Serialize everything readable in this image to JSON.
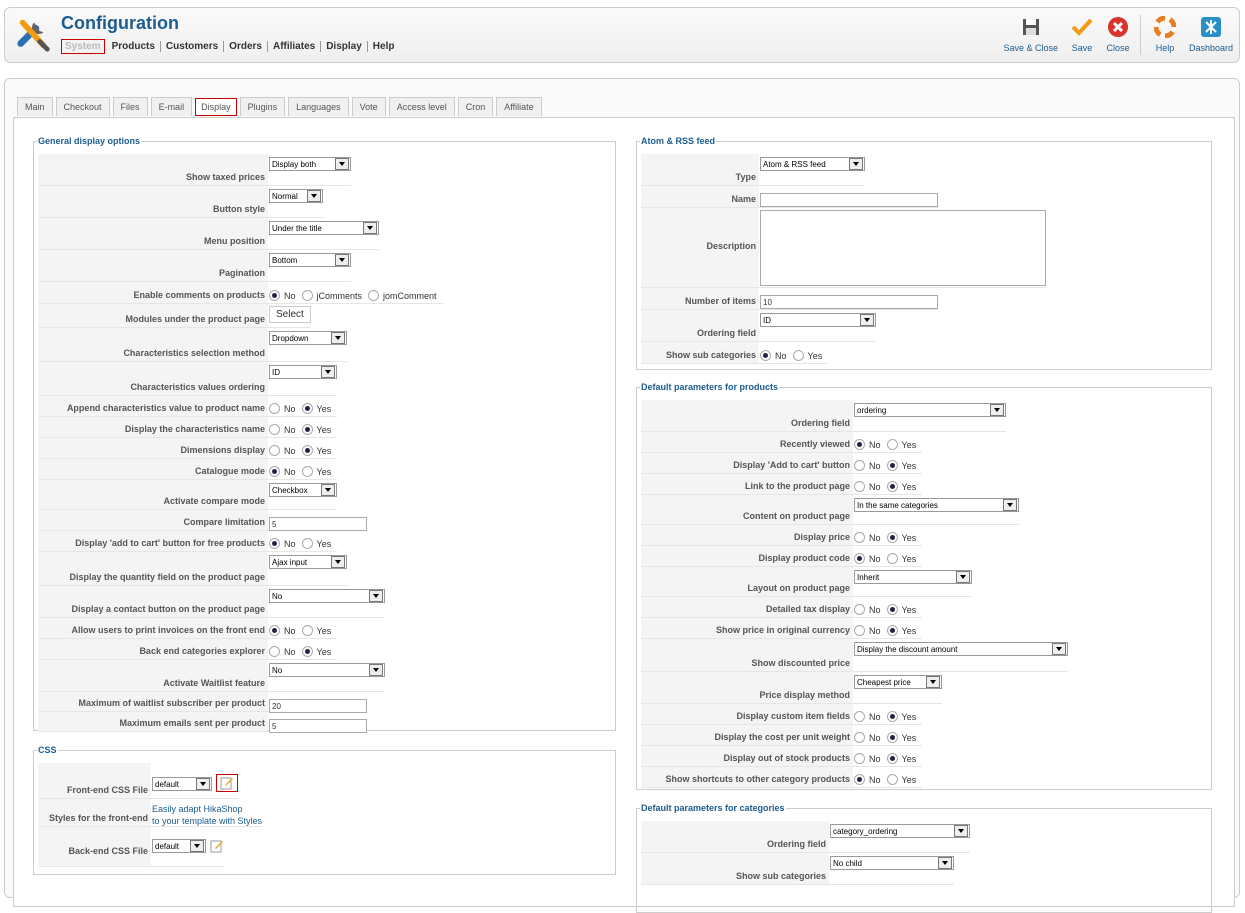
{
  "header": {
    "title": "Configuration",
    "nav": [
      "System",
      "Products",
      "Customers",
      "Orders",
      "Affiliates",
      "Display",
      "Help"
    ],
    "toolbar": {
      "save_close": "Save & Close",
      "save": "Save",
      "close": "Close",
      "help": "Help",
      "dashboard": "Dashboard"
    }
  },
  "tabs": [
    "Main",
    "Checkout",
    "Files",
    "E-mail",
    "Display",
    "Plugins",
    "Languages",
    "Vote",
    "Access level",
    "Cron",
    "Affiliate"
  ],
  "general": {
    "legend": "General display options",
    "rows": [
      {
        "label": "Show taxed prices",
        "type": "select",
        "value": "Display both"
      },
      {
        "label": "Button style",
        "type": "select",
        "value": "Normal"
      },
      {
        "label": "Menu position",
        "type": "select",
        "value": "Under the title"
      },
      {
        "label": "Pagination",
        "type": "select",
        "value": "Bottom"
      },
      {
        "label": "Enable comments on products",
        "type": "radio",
        "options": [
          "No",
          "jComments",
          "jomComment"
        ],
        "selected": 0
      },
      {
        "label": "Modules under the product page",
        "type": "button",
        "value": "Select"
      },
      {
        "label": "Characteristics selection method",
        "type": "select",
        "value": "Dropdown"
      },
      {
        "label": "Characteristics values ordering",
        "type": "select",
        "value": "ID"
      },
      {
        "label": "Append characteristics value to product name",
        "type": "radio",
        "options": [
          "No",
          "Yes"
        ],
        "selected": 1
      },
      {
        "label": "Display the characteristics name",
        "type": "radio",
        "options": [
          "No",
          "Yes"
        ],
        "selected": 1
      },
      {
        "label": "Dimensions display",
        "type": "radio",
        "options": [
          "No",
          "Yes"
        ],
        "selected": 1
      },
      {
        "label": "Catalogue mode",
        "type": "radio",
        "options": [
          "No",
          "Yes"
        ],
        "selected": 0
      },
      {
        "label": "Activate compare mode",
        "type": "select",
        "value": "Checkbox"
      },
      {
        "label": "Compare limitation",
        "type": "input",
        "value": "5"
      },
      {
        "label": "Display 'add to cart' button for free products",
        "type": "radio",
        "options": [
          "No",
          "Yes"
        ],
        "selected": 0
      },
      {
        "label": "Display the quantity field on the product page",
        "type": "select",
        "value": "Ajax input"
      },
      {
        "label": "Display a contact button on the product page",
        "type": "select",
        "value": "No"
      },
      {
        "label": "Allow users to print invoices on the front end",
        "type": "radio",
        "options": [
          "No",
          "Yes"
        ],
        "selected": 0
      },
      {
        "label": "Back end categories explorer",
        "type": "radio",
        "options": [
          "No",
          "Yes"
        ],
        "selected": 1
      },
      {
        "label": "Activate Waitlist feature",
        "type": "select",
        "value": "No"
      },
      {
        "label": "Maximum of waitlist subscriber per product",
        "type": "input",
        "value": "20"
      },
      {
        "label": "Maximum emails sent per product",
        "type": "input",
        "value": "5"
      }
    ]
  },
  "css": {
    "legend": "CSS",
    "front_label": "Front-end CSS File",
    "front_value": "default",
    "styles_label": "Styles for the front-end",
    "styles_link1": "Easily adapt HikaShop",
    "styles_link2": "to your template with Styles",
    "back_label": "Back-end CSS File",
    "back_value": "default"
  },
  "rss": {
    "legend": "Atom & RSS feed",
    "rows": [
      {
        "label": "Type",
        "type": "select",
        "value": "Atom & RSS feed"
      },
      {
        "label": "Name",
        "type": "input",
        "value": ""
      },
      {
        "label": "Description",
        "type": "textarea",
        "value": ""
      },
      {
        "label": "Number of items",
        "type": "input",
        "value": "10"
      },
      {
        "label": "Ordering field",
        "type": "select",
        "value": "ID"
      },
      {
        "label": "Show sub categories",
        "type": "radio",
        "options": [
          "No",
          "Yes"
        ],
        "selected": 0
      }
    ]
  },
  "products": {
    "legend": "Default parameters for products",
    "rows": [
      {
        "label": "Ordering field",
        "type": "select",
        "value": "ordering"
      },
      {
        "label": "Recently viewed",
        "type": "radio",
        "options": [
          "No",
          "Yes"
        ],
        "selected": 0
      },
      {
        "label": "Display 'Add to cart' button",
        "type": "radio",
        "options": [
          "No",
          "Yes"
        ],
        "selected": 1
      },
      {
        "label": "Link to the product page",
        "type": "radio",
        "options": [
          "No",
          "Yes"
        ],
        "selected": 1
      },
      {
        "label": "Content on product page",
        "type": "select",
        "value": "In the same categories"
      },
      {
        "label": "Display price",
        "type": "radio",
        "options": [
          "No",
          "Yes"
        ],
        "selected": 1
      },
      {
        "label": "Display product code",
        "type": "radio",
        "options": [
          "No",
          "Yes"
        ],
        "selected": 0
      },
      {
        "label": "Layout on product page",
        "type": "select",
        "value": "Inherit"
      },
      {
        "label": "Detailed tax display",
        "type": "radio",
        "options": [
          "No",
          "Yes"
        ],
        "selected": 1
      },
      {
        "label": "Show price in original currency",
        "type": "radio",
        "options": [
          "No",
          "Yes"
        ],
        "selected": 1
      },
      {
        "label": "Show discounted price",
        "type": "select",
        "value": "Display the discount amount"
      },
      {
        "label": "Price display method",
        "type": "select",
        "value": "Cheapest price"
      },
      {
        "label": "Display custom item fields",
        "type": "radio",
        "options": [
          "No",
          "Yes"
        ],
        "selected": 1
      },
      {
        "label": "Display the cost per unit weight",
        "type": "radio",
        "options": [
          "No",
          "Yes"
        ],
        "selected": 1
      },
      {
        "label": "Display out of stock products",
        "type": "radio",
        "options": [
          "No",
          "Yes"
        ],
        "selected": 1
      },
      {
        "label": "Show shortcuts to other category products",
        "type": "radio",
        "options": [
          "No",
          "Yes"
        ],
        "selected": 0
      }
    ]
  },
  "categories": {
    "legend": "Default parameters for categories",
    "rows": [
      {
        "label": "Ordering field",
        "type": "select",
        "value": "category_ordering"
      },
      {
        "label": "Show sub categories",
        "type": "select",
        "value": "No child"
      }
    ]
  }
}
